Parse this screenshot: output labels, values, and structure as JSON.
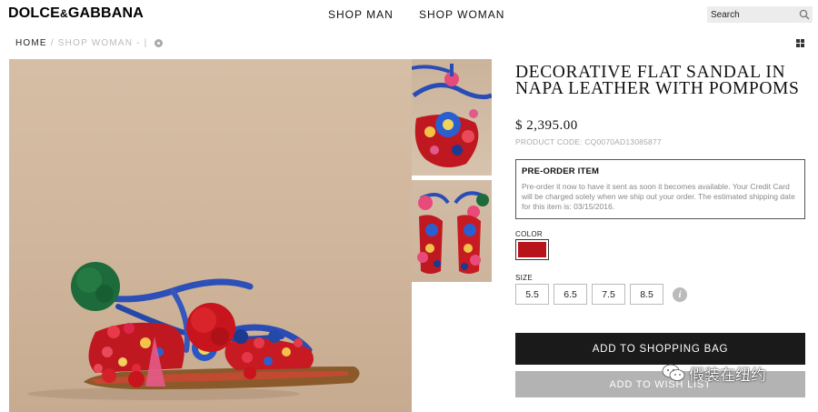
{
  "header": {
    "logo_main": "DOLCE",
    "logo_amp": "&",
    "logo_end": "GABBANA",
    "nav": [
      "SHOP MAN",
      "SHOP WOMAN"
    ],
    "search_placeholder": "Search"
  },
  "breadcrumb": {
    "home": "HOME",
    "separator": "/",
    "current": "SHOP WOMAN - |"
  },
  "product": {
    "title": "DECORATIVE FLAT SANDAL IN NAPA LEATHER WITH POMPOMS",
    "price": "$ 2,395.00",
    "code": "PRODUCT CODE: CQ0070AD13085877",
    "preorder": {
      "title": "PRE-ORDER ITEM",
      "text": "Pre-order it now to have it sent as soon it becomes available. Your Credit Card will be charged solely when we ship out your order. The estimated shipping date for this item is: 03/15/2016."
    },
    "color_label": "COLOR",
    "color_value": "#b8121a",
    "size_label": "SIZE",
    "sizes": [
      "5.5",
      "6.5",
      "7.5",
      "8.5"
    ],
    "info_icon_glyph": "i",
    "add_to_bag": "ADD TO SHOPPING BAG",
    "add_to_wishlist": "ADD TO WISH LIST"
  },
  "watermark": {
    "text": "假装在纽约"
  },
  "colors": {
    "accent_red": "#b8121a",
    "button_dark": "#1a1a1a",
    "button_grey": "#b3b3b3"
  }
}
